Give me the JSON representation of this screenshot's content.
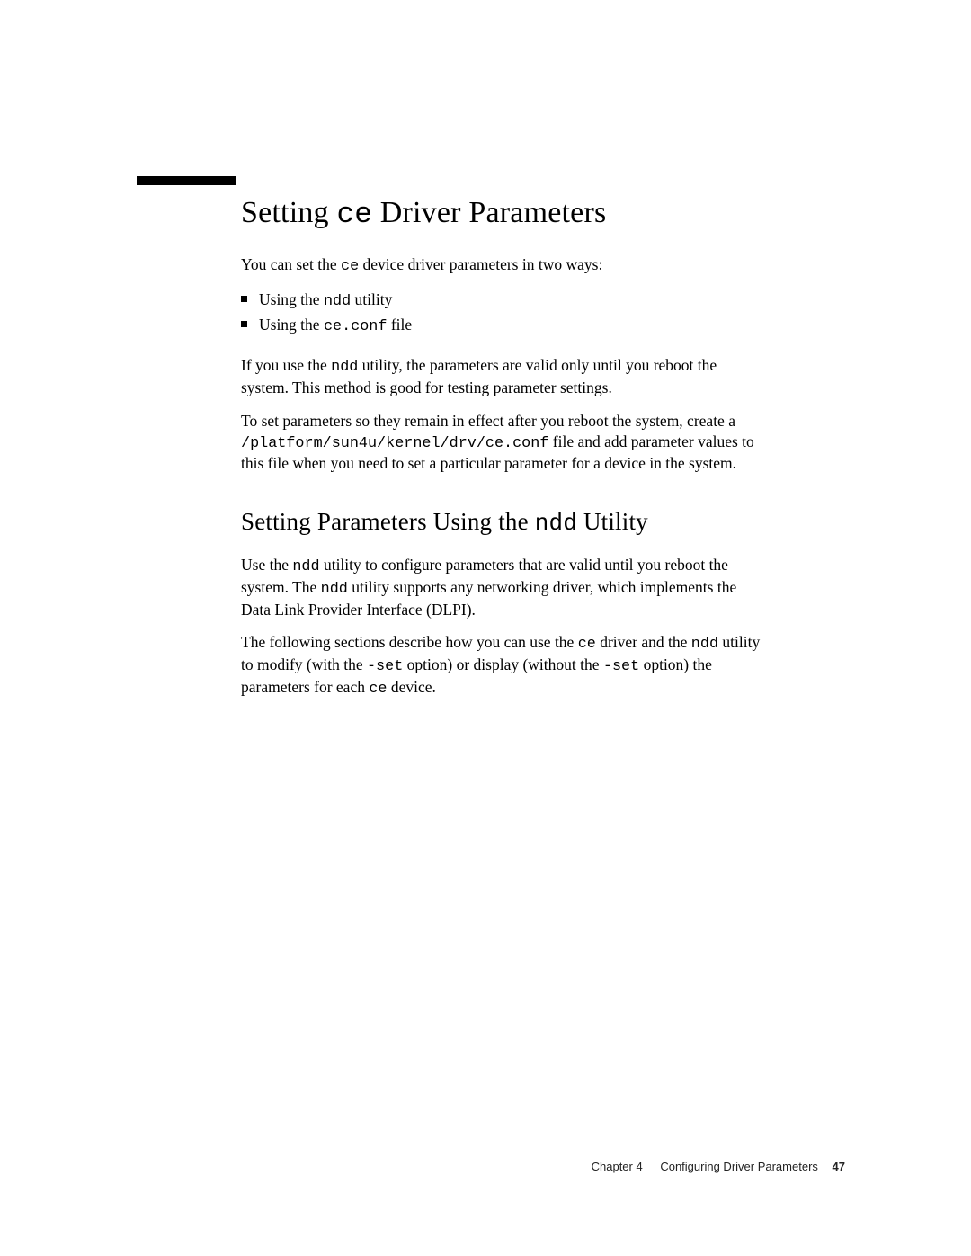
{
  "heading1": {
    "pre": "Setting ",
    "code": "ce",
    "post": " Driver Parameters"
  },
  "intro": {
    "pre": "You can set the ",
    "code": "ce",
    "post": " device driver parameters in two ways:"
  },
  "bullets": [
    {
      "pre": "Using the ",
      "code": "ndd",
      "post": " utility"
    },
    {
      "pre": "Using the ",
      "code": "ce.conf",
      "post": " file"
    }
  ],
  "para2": {
    "pre": "If you use the ",
    "code": "ndd",
    "post": " utility, the parameters are valid only until you reboot the system. This method is good for testing parameter settings."
  },
  "para3": {
    "a": "To set parameters so they remain in effect after you reboot the system, create a ",
    "code": "/platform/sun4u/kernel/drv/ce.conf",
    "b": " file and add parameter values to this file when you need to set a particular parameter for a device in the system."
  },
  "heading2": {
    "pre": "Setting Parameters Using the ",
    "code": "ndd",
    "post": " Utility"
  },
  "para4": {
    "a": "Use the ",
    "c1": "ndd",
    "b": " utility to configure parameters that are valid until you reboot the system. The ",
    "c2": "ndd",
    "c": " utility supports any networking driver, which implements the Data Link Provider Interface (DLPI)."
  },
  "para5": {
    "a": "The following sections describe how you can use the ",
    "c1": "ce",
    "b": " driver and the ",
    "c2": "ndd",
    "c": " utility to modify (with the ",
    "c3": "-set",
    "d": " option) or display (without the ",
    "c4": "-set",
    "e": " option) the parameters for each ",
    "c5": "ce",
    "f": " device."
  },
  "footer": {
    "chapter": "Chapter 4",
    "title": "Configuring Driver Parameters",
    "page": "47"
  }
}
